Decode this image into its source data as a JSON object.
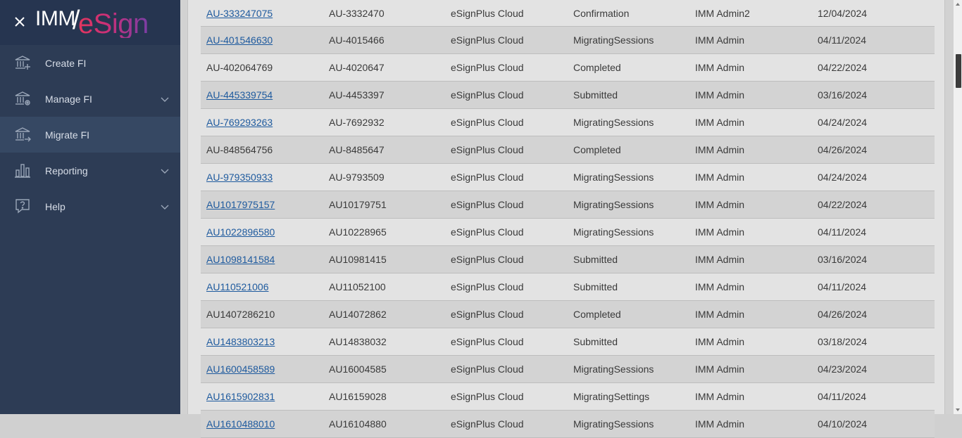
{
  "app": {
    "logo_left": "IMM",
    "logo_right": "eSign"
  },
  "sidebar": {
    "items": [
      {
        "label": "Create FI",
        "icon": "bank-plus-icon",
        "active": false,
        "expandable": false
      },
      {
        "label": "Manage FI",
        "icon": "bank-gear-icon",
        "active": false,
        "expandable": true
      },
      {
        "label": "Migrate FI",
        "icon": "bank-arrow-icon",
        "active": true,
        "expandable": false
      },
      {
        "label": "Reporting",
        "icon": "bar-chart-icon",
        "active": false,
        "expandable": true
      },
      {
        "label": "Help",
        "icon": "help-icon",
        "active": false,
        "expandable": true
      }
    ]
  },
  "table": {
    "rows": [
      {
        "id": "AU-333247075",
        "linked": true,
        "code": "AU-3332470",
        "env": "eSignPlus Cloud",
        "status": "Confirmation",
        "user": "IMM Admin2",
        "date": "12/04/2024"
      },
      {
        "id": "AU-401546630",
        "linked": true,
        "code": "AU-4015466",
        "env": "eSignPlus Cloud",
        "status": "MigratingSessions",
        "user": "IMM Admin",
        "date": "04/11/2024"
      },
      {
        "id": "AU-402064769",
        "linked": false,
        "code": "AU-4020647",
        "env": "eSignPlus Cloud",
        "status": "Completed",
        "user": "IMM Admin",
        "date": "04/22/2024"
      },
      {
        "id": "AU-445339754",
        "linked": true,
        "code": "AU-4453397",
        "env": "eSignPlus Cloud",
        "status": "Submitted",
        "user": "IMM Admin",
        "date": "03/16/2024"
      },
      {
        "id": "AU-769293263",
        "linked": true,
        "code": "AU-7692932",
        "env": "eSignPlus Cloud",
        "status": "MigratingSessions",
        "user": "IMM Admin",
        "date": "04/24/2024"
      },
      {
        "id": "AU-848564756",
        "linked": false,
        "code": "AU-8485647",
        "env": "eSignPlus Cloud",
        "status": "Completed",
        "user": "IMM Admin",
        "date": "04/26/2024"
      },
      {
        "id": "AU-979350933",
        "linked": true,
        "code": "AU-9793509",
        "env": "eSignPlus Cloud",
        "status": "MigratingSessions",
        "user": "IMM Admin",
        "date": "04/24/2024"
      },
      {
        "id": "AU1017975157",
        "linked": true,
        "code": "AU10179751",
        "env": "eSignPlus Cloud",
        "status": "MigratingSessions",
        "user": "IMM Admin",
        "date": "04/22/2024"
      },
      {
        "id": "AU1022896580",
        "linked": true,
        "code": "AU10228965",
        "env": "eSignPlus Cloud",
        "status": "MigratingSessions",
        "user": "IMM Admin",
        "date": "04/11/2024"
      },
      {
        "id": "AU1098141584",
        "linked": true,
        "code": "AU10981415",
        "env": "eSignPlus Cloud",
        "status": "Submitted",
        "user": "IMM Admin",
        "date": "03/16/2024"
      },
      {
        "id": "AU110521006",
        "linked": true,
        "code": "AU11052100",
        "env": "eSignPlus Cloud",
        "status": "Submitted",
        "user": "IMM Admin",
        "date": "04/11/2024"
      },
      {
        "id": "AU1407286210",
        "linked": false,
        "code": "AU14072862",
        "env": "eSignPlus Cloud",
        "status": "Completed",
        "user": "IMM Admin",
        "date": "04/26/2024"
      },
      {
        "id": "AU1483803213",
        "linked": true,
        "code": "AU14838032",
        "env": "eSignPlus Cloud",
        "status": "Submitted",
        "user": "IMM Admin",
        "date": "03/18/2024"
      },
      {
        "id": "AU1600458589",
        "linked": true,
        "code": "AU16004585",
        "env": "eSignPlus Cloud",
        "status": "MigratingSessions",
        "user": "IMM Admin",
        "date": "04/23/2024"
      },
      {
        "id": "AU1615902831",
        "linked": true,
        "code": "AU16159028",
        "env": "eSignPlus Cloud",
        "status": "MigratingSettings",
        "user": "IMM Admin",
        "date": "04/11/2024"
      },
      {
        "id": "AU1610488010",
        "linked": true,
        "code": "AU16104880",
        "env": "eSignPlus Cloud",
        "status": "MigratingSessions",
        "user": "IMM Admin",
        "date": "04/10/2024"
      }
    ]
  }
}
